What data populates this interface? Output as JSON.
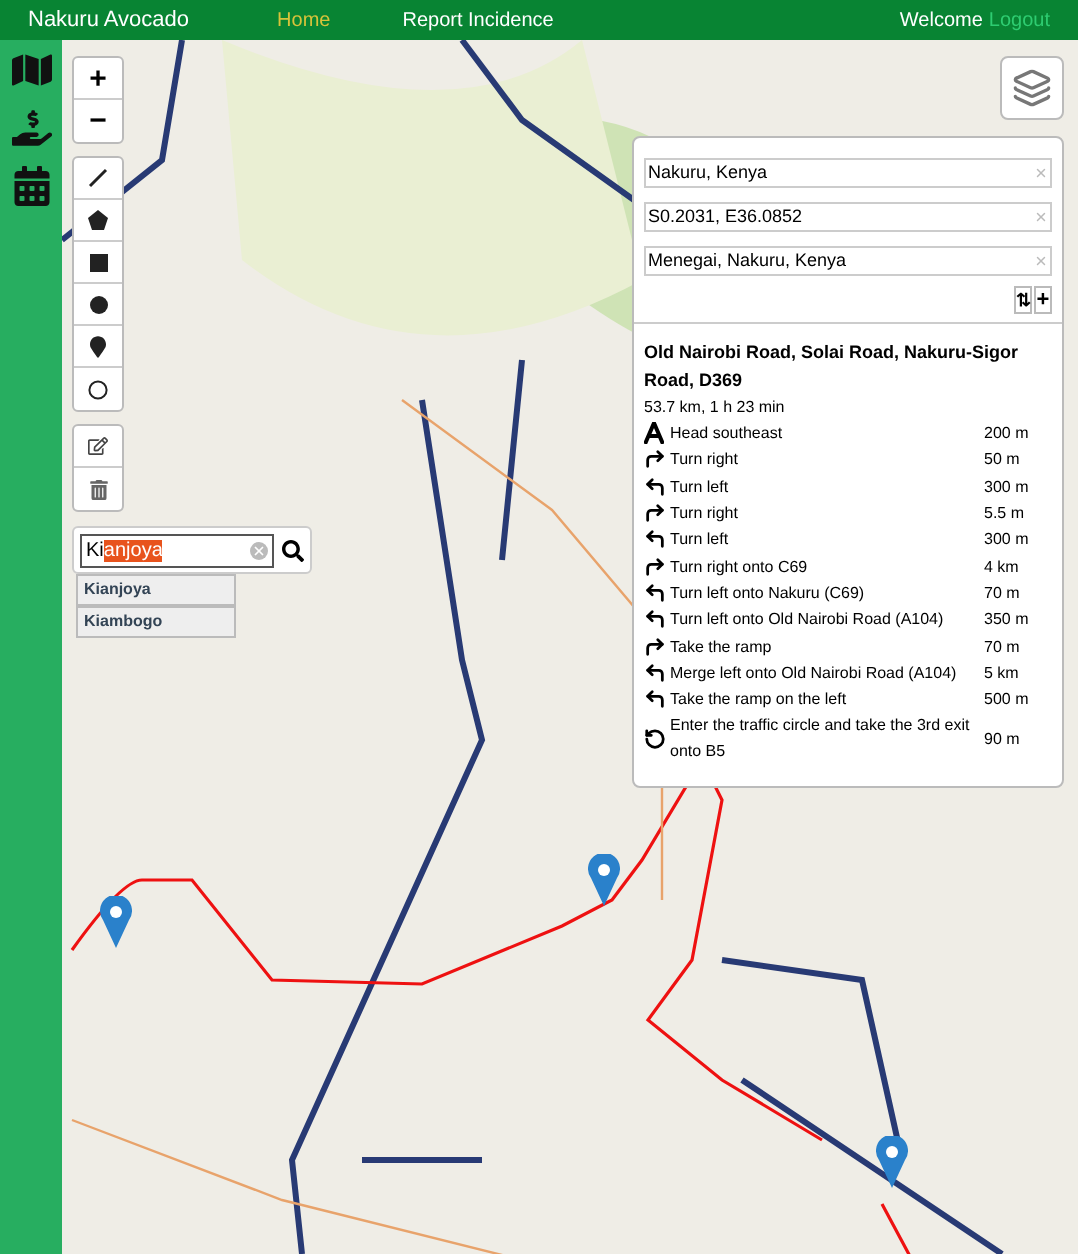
{
  "navbar": {
    "brand": "Nakuru Avocado",
    "links": [
      {
        "label": "Home",
        "selected": true
      },
      {
        "label": "Report Incidence",
        "selected": false
      }
    ],
    "welcome": "Welcome",
    "logout": "Logout"
  },
  "sidebar": {
    "items": [
      {
        "kind": "map"
      },
      {
        "kind": "hand"
      },
      {
        "kind": "calendar"
      }
    ]
  },
  "map_controls": {
    "zoom_in": "+",
    "zoom_out": "−",
    "draw_tools": [
      {
        "kind": "line"
      },
      {
        "kind": "polygon"
      },
      {
        "kind": "rectangle"
      },
      {
        "kind": "circle"
      },
      {
        "kind": "marker"
      },
      {
        "kind": "circle-marker"
      }
    ],
    "edit_tools": [
      {
        "kind": "edit"
      },
      {
        "kind": "delete"
      }
    ]
  },
  "search": {
    "typed": "Ki",
    "completion": "anjoya",
    "suggestions": [
      "Kianjoya",
      "Kiambogo"
    ]
  },
  "routing": {
    "waypoints": [
      "Nakuru, Kenya",
      "S0.2031, E36.0852",
      "Menegai, Nakuru, Kenya"
    ],
    "reverse": "⇅",
    "add": "+",
    "route_title": "Old Nairobi Road, Solai Road, Nakuru-Sigor Road, D369",
    "summary": "53.7 km, 1 h 23 min",
    "steps": [
      {
        "kind": "depart",
        "text": "Head southeast",
        "distance": "200 m"
      },
      {
        "kind": "right",
        "text": "Turn right",
        "distance": "50 m"
      },
      {
        "kind": "left",
        "text": "Turn left",
        "distance": "300 m"
      },
      {
        "kind": "right",
        "text": "Turn right",
        "distance": "5.5 m"
      },
      {
        "kind": "left",
        "text": "Turn left",
        "distance": "300 m"
      },
      {
        "kind": "right",
        "text": "Turn right onto C69",
        "distance": "4 km"
      },
      {
        "kind": "left",
        "text": "Turn left onto Nakuru (C69)",
        "distance": "70 m"
      },
      {
        "kind": "left",
        "text": "Turn left onto Old Nairobi Road (A104)",
        "distance": "350 m"
      },
      {
        "kind": "right",
        "text": "Take the ramp",
        "distance": "70 m"
      },
      {
        "kind": "left",
        "text": "Merge left onto Old Nairobi Road (A104)",
        "distance": "5 km"
      },
      {
        "kind": "left",
        "text": "Take the ramp on the left",
        "distance": "500 m"
      },
      {
        "kind": "roundabout",
        "text": "Enter the traffic circle and take the 3rd exit onto B5",
        "distance": "90 m"
      }
    ]
  }
}
